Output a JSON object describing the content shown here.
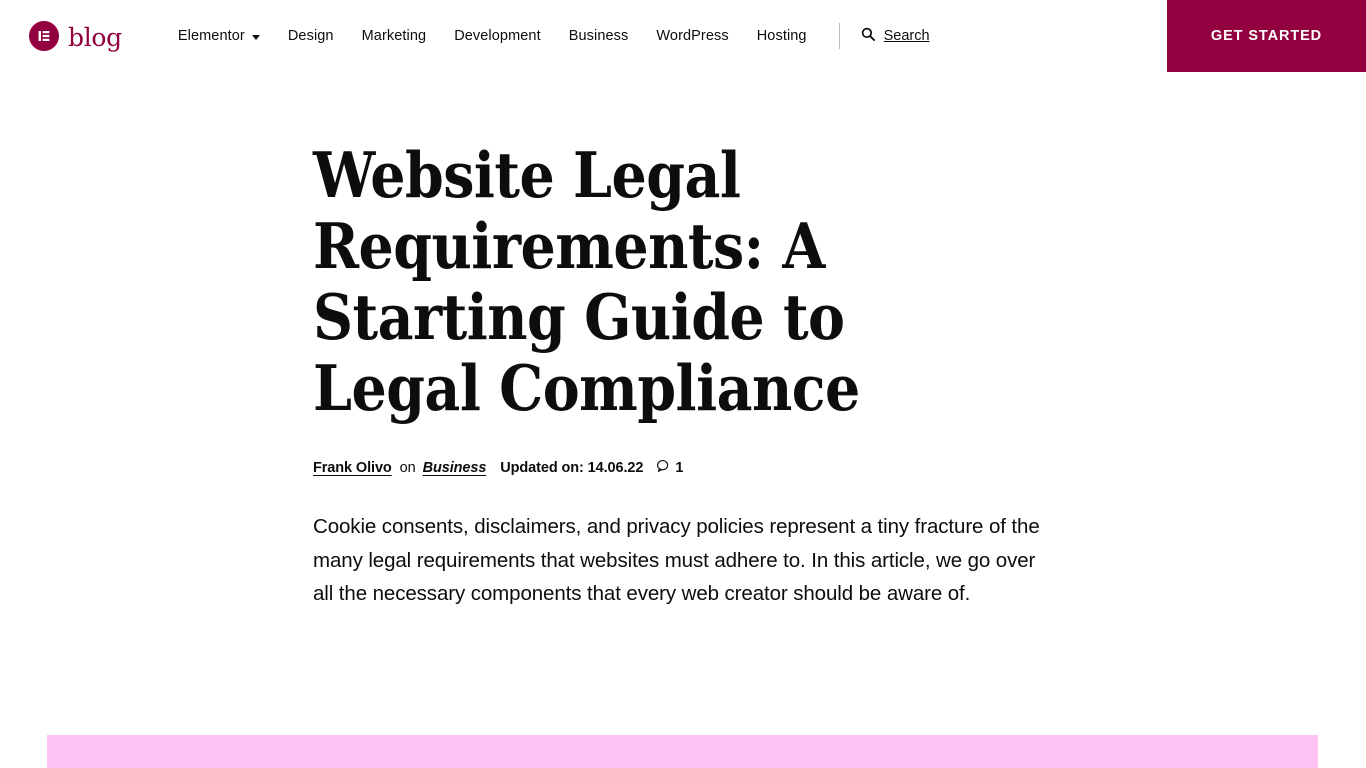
{
  "header": {
    "logo": {
      "icon": "elementor-logo-icon",
      "text": "blog"
    },
    "nav_items": [
      {
        "label": "Elementor",
        "has_dropdown": true
      },
      {
        "label": "Design",
        "has_dropdown": false
      },
      {
        "label": "Marketing",
        "has_dropdown": false
      },
      {
        "label": "Development",
        "has_dropdown": false
      },
      {
        "label": "Business",
        "has_dropdown": false
      },
      {
        "label": "WordPress",
        "has_dropdown": false
      },
      {
        "label": "Hosting",
        "has_dropdown": false
      }
    ],
    "search": {
      "label": "Search",
      "icon": "search-icon"
    },
    "cta": {
      "label": "GET STARTED"
    }
  },
  "article": {
    "title": "Website Legal Requirements: A Starting Guide to Legal Compliance",
    "meta": {
      "author": "Frank Olivo",
      "preposition": "on",
      "category": "Business",
      "updated": "Updated on: 14.06.22",
      "comment_icon": "comment-bubble-icon",
      "comment_count": "1"
    },
    "excerpt": "Cookie consents, disclaimers, and privacy policies represent a tiny fracture of the many legal requirements that websites must adhere to. In this article, we go over all the necessary components that every web creator should be aware of."
  },
  "colors": {
    "brand": "#93003F",
    "banner_pink": "#FDC1F2",
    "text": "#0C0D0E"
  }
}
